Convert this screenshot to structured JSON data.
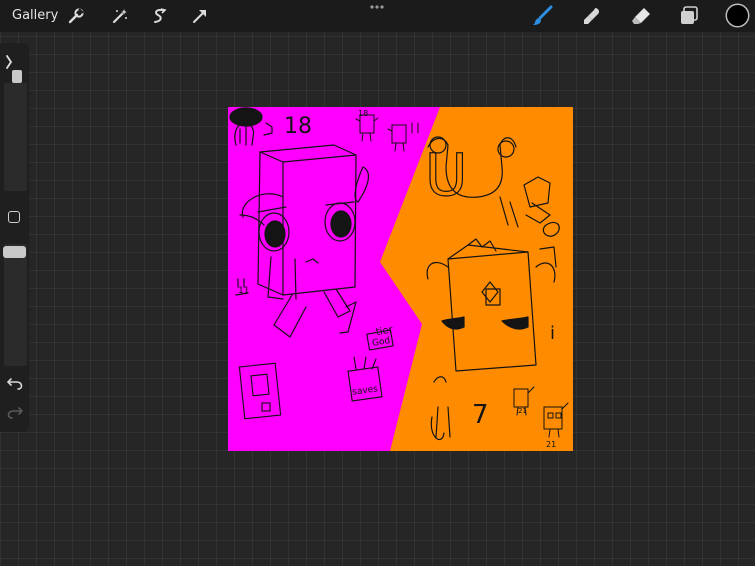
{
  "app": {
    "gallery_label": "Gallery"
  },
  "toolbar": {
    "left_tools": [
      "wrench-icon",
      "magic-wand-icon",
      "selection-icon",
      "transform-icon"
    ],
    "right_tools": [
      "brush-icon",
      "smudge-icon",
      "eraser-icon",
      "layers-icon"
    ],
    "active_tool": "brush-icon",
    "active_color": "#2e8ee0",
    "current_color": "#000000"
  },
  "sidebar": {
    "brush_size": 0.12,
    "brush_opacity": 0.03
  },
  "canvas": {
    "left_bg": "#ff00ff",
    "right_bg": "#ff8c00",
    "ink": "#141414",
    "labels": {
      "eighteen": "18",
      "eighteen_small": "18",
      "uwu": "U",
      "eleven": "11",
      "tier": "tier",
      "god": "God",
      "saves": "saves",
      "i_mark": "i",
      "seven": "7",
      "twentyone_a": "21",
      "twentyone_b": "21"
    }
  }
}
